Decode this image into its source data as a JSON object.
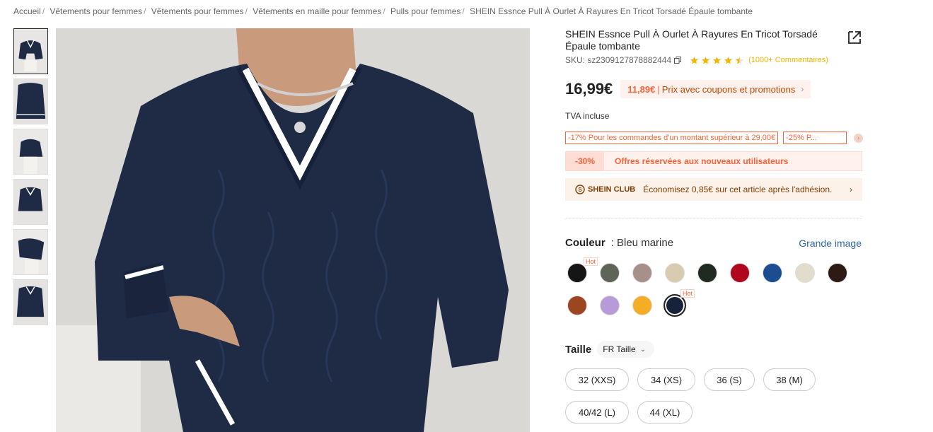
{
  "breadcrumb": [
    "Accueil",
    "Vêtements pour femmes",
    "Vêtements pour femmes",
    "Vêtements en maille pour femmes",
    "Pulls pour femmes",
    "SHEIN Essnce Pull À Ourlet À Rayures En Tricot Torsadé Épaule tombante"
  ],
  "breadcrumb_separator": "/",
  "product": {
    "title": "SHEIN Essnce Pull À Ourlet À Rayures En Tricot Torsadé Épaule tombante",
    "sku": "SKU: sz2309127878882444",
    "rating": 4.5,
    "reviews": "(1000+ Commentaires)",
    "price": "16,99€",
    "coupon_price": "11,89€",
    "coupon_separator": "|",
    "coupon_text": "Prix avec coupons et promotions",
    "vat": "TVA incluse",
    "promos": [
      "-17% Pour les commandes d'un montant supérieur à 29,00€",
      "-25% P..."
    ],
    "new_user_badge": "-30%",
    "new_user_text": "Offres réservées aux nouveaux utilisateurs",
    "club_name": "SHEIN CLUB",
    "club_text": "Économisez 0,85€ sur cet article après l'adhésion."
  },
  "color": {
    "label": "Couleur",
    "value": ": Bleu marine",
    "big_image": "Grande image",
    "hot_label": "Hot",
    "swatches": [
      {
        "color": "#151515",
        "hot": true
      },
      {
        "color": "#5e6458",
        "hot": false
      },
      {
        "color": "#a69089",
        "hot": false
      },
      {
        "color": "#d9cbb0",
        "hot": false
      },
      {
        "color": "#1f2a20",
        "hot": false
      },
      {
        "color": "#b1071e",
        "hot": false
      },
      {
        "color": "#1c4d91",
        "hot": false
      },
      {
        "color": "#e2dccd",
        "hot": false
      },
      {
        "color": "#2e1a14",
        "hot": false
      },
      {
        "color": "#9b4521",
        "hot": false
      },
      {
        "color": "#b79ad8",
        "hot": false
      },
      {
        "color": "#f5ad25",
        "hot": false
      },
      {
        "color": "#16213a",
        "hot": true,
        "selected": true
      }
    ]
  },
  "size": {
    "label": "Taille",
    "selector": "FR Taille",
    "options": [
      "32 (XXS)",
      "34 (XS)",
      "36 (S)",
      "38 (M)",
      "40/42 (L)",
      "44 (XL)"
    ]
  },
  "colors": {
    "accent": "#fa6338",
    "link": "#2d68a8",
    "star": "#f6b500",
    "sweater": "#1f2b45"
  },
  "icons": [
    "share-icon",
    "copy-icon",
    "star-icon",
    "chevron-right-icon",
    "shein-club-icon",
    "chevron-down-icon"
  ]
}
